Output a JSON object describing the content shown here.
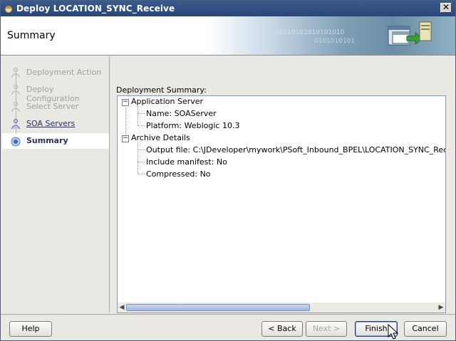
{
  "window": {
    "title": "Deploy LOCATION_SYNC_Receive",
    "close_label": "✕"
  },
  "header": {
    "heading": "Summary"
  },
  "nav": {
    "items": [
      {
        "label": "Deployment Action",
        "state": "disabled"
      },
      {
        "label": "Deploy Configuration",
        "state": "disabled"
      },
      {
        "label": "Select Server",
        "state": "disabled"
      },
      {
        "label": "SOA Servers",
        "state": "link"
      },
      {
        "label": "Summary",
        "state": "active"
      }
    ]
  },
  "main": {
    "summary_label": "Deployment Summary:",
    "tree": {
      "application_server": {
        "label": "Application Server",
        "name": "Name: SOAServer",
        "platform": "Platform: Weblogic 10.3"
      },
      "archive_details": {
        "label": "Archive Details",
        "output_file": "Output file: C:\\JDeveloper\\mywork\\PSoft_Inbound_BPEL\\LOCATION_SYNC_Receive\\de",
        "include_manifest": "Include manifest: No",
        "compressed": "Compressed: No"
      }
    }
  },
  "buttons": {
    "help": "Help",
    "back": "< Back",
    "next": "Next >",
    "finish": "Finish",
    "cancel": "Cancel"
  },
  "colors": {
    "title_bar": "#2f4e82",
    "nav_link": "#26315b",
    "panel_bg": "#e9e8e2"
  }
}
